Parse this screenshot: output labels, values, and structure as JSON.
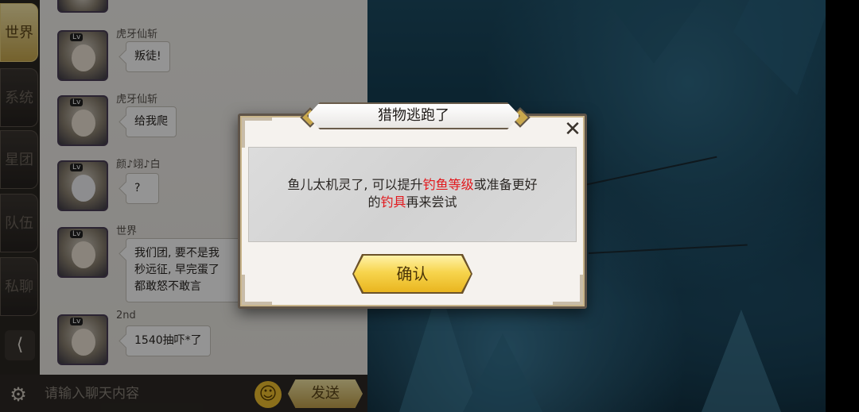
{
  "chat": {
    "tabs": [
      {
        "label": "世界",
        "active": true
      },
      {
        "label": "系统",
        "active": false
      },
      {
        "label": "星团",
        "active": false
      },
      {
        "label": "队伍",
        "active": false
      },
      {
        "label": "私聊",
        "active": false
      }
    ],
    "messages": [
      {
        "sender": "虎牙仙斩",
        "text": "叛徒!"
      },
      {
        "sender": "虎牙仙斩",
        "text": "给我爬"
      },
      {
        "sender": "颜♪翊♪白",
        "text": "?"
      },
      {
        "sender": "世界",
        "text": "我们团, 要不是我\n秒远征, 早完蛋了\n都敢怒不敢言"
      },
      {
        "sender": "2nd",
        "text": "1540抽吓*了"
      }
    ],
    "input_placeholder": "请输入聊天内容",
    "send_label": "发送",
    "level_badge": "Lv"
  },
  "dialog": {
    "title": "猎物逃跑了",
    "message_part1": "鱼儿太机灵了, 可以提升",
    "highlight1": "钓鱼等级",
    "message_part2": "或准备更好",
    "message_part3": "的",
    "highlight2": "钓具",
    "message_part4": "再来尝试",
    "confirm_label": "确认",
    "close_symbol": "✕"
  },
  "colors": {
    "highlight": "#e2161b",
    "gold": "#f7d54e",
    "panel": "#f5f2ee"
  },
  "icons": {
    "share": "share-icon",
    "settings": "gear-icon",
    "emoji": "smiley-icon",
    "close": "close-icon"
  }
}
